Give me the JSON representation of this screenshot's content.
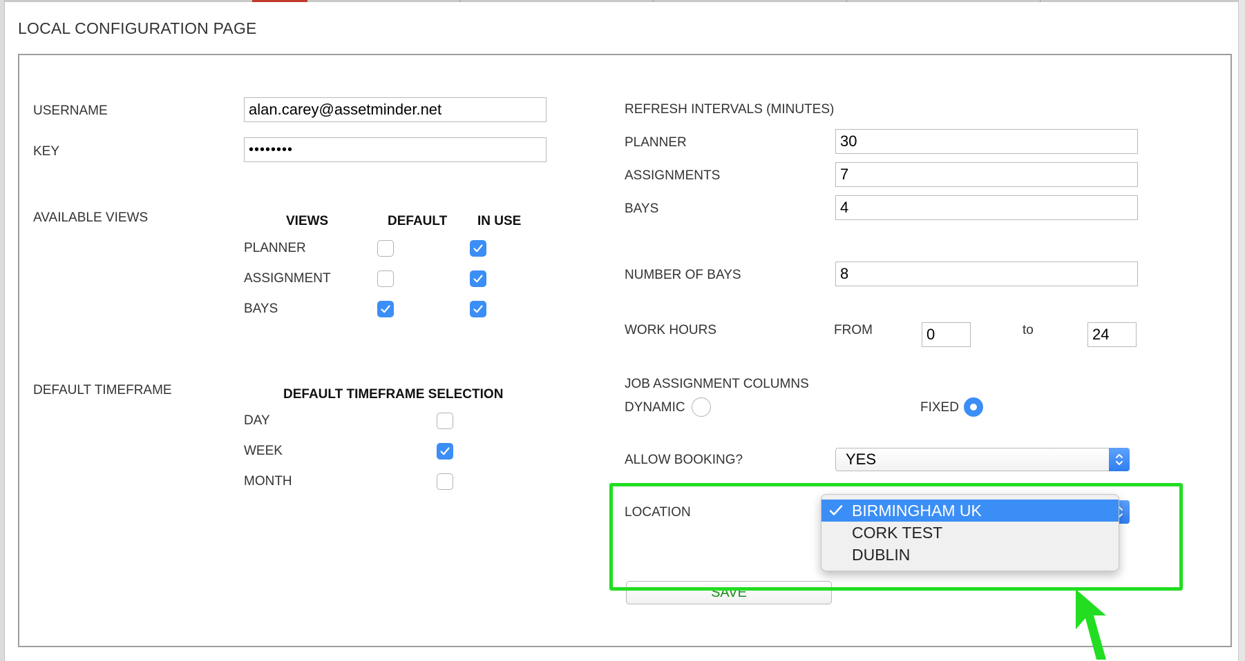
{
  "page": {
    "title": "LOCAL CONFIGURATION PAGE"
  },
  "credentials": {
    "username_label": "USERNAME",
    "username_value": "alan.carey@assetminder.net",
    "key_label": "KEY",
    "key_value": "password"
  },
  "views": {
    "section_label": "AVAILABLE VIEWS",
    "col_views": "VIEWS",
    "col_default": "DEFAULT",
    "col_in_use": "IN USE",
    "rows": [
      {
        "label": "PLANNER",
        "default": false,
        "in_use": true
      },
      {
        "label": "ASSIGNMENT",
        "default": false,
        "in_use": true
      },
      {
        "label": "BAYS",
        "default": true,
        "in_use": true
      }
    ]
  },
  "timeframe": {
    "section_label": "DEFAULT TIMEFRAME",
    "header": "DEFAULT TIMEFRAME SELECTION",
    "rows": [
      {
        "label": "DAY",
        "checked": false
      },
      {
        "label": "WEEK",
        "checked": true
      },
      {
        "label": "MONTH",
        "checked": false
      }
    ]
  },
  "refresh": {
    "section_label": "REFRESH INTERVALS (MINUTES)",
    "planner_label": "PLANNER",
    "planner_value": "30",
    "assignments_label": "ASSIGNMENTS",
    "assignments_value": "7",
    "bays_label": "BAYS",
    "bays_value": "4"
  },
  "bays": {
    "label": "NUMBER OF BAYS",
    "value": "8"
  },
  "work_hours": {
    "label": "WORK HOURS",
    "from_label": "FROM",
    "from_value": "0",
    "to_label": "to",
    "to_value": "24"
  },
  "job_columns": {
    "label": "JOB ASSIGNMENT COLUMNS",
    "dynamic_label": "DYNAMIC",
    "fixed_label": "FIXED",
    "selected": "FIXED"
  },
  "booking": {
    "label": "ALLOW BOOKING?",
    "value": "YES"
  },
  "location": {
    "label": "LOCATION",
    "options": [
      "BIRMINGHAM UK",
      "CORK TEST",
      "DUBLIN"
    ],
    "selected": "BIRMINGHAM UK"
  },
  "save": {
    "label": "SAVE"
  },
  "colors": {
    "accent_blue": "#3b8ef5",
    "highlight_green": "#22dd22",
    "save_text_green": "#1f8c1f"
  }
}
